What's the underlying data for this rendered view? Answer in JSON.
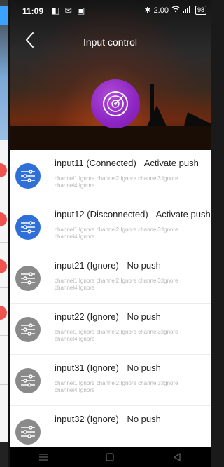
{
  "status_bar": {
    "time": "11:09",
    "left_icons": "◧ ✉ ▣",
    "speed": "2.00",
    "battery": "98"
  },
  "header": {
    "title": "Input control",
    "back_icon": "chevron-left-icon",
    "badge_icon": "radar-icon"
  },
  "inputs": [
    {
      "name": "input11",
      "state": "(Connected)",
      "push": "Activate push",
      "channels": [
        "channel1:Ignore  channel2:Ignore  channel3:Ignore",
        "channel4:Ignore"
      ],
      "icon_color": "#2e6fd8"
    },
    {
      "name": "input12",
      "state": "(Disconnected)",
      "push": "Activate push",
      "channels": [
        "channel1:Ignore  channel2:Ignore  channel3:Ignore",
        "channel4:Ignore"
      ],
      "icon_color": "#2e6fd8"
    },
    {
      "name": "input21",
      "state": "(Ignore)",
      "push": "No push",
      "channels": [
        "channel1:Ignore  channel2:Ignore  channel3:Ignore",
        "channel4:Ignore"
      ],
      "icon_color": "#8a8a8a"
    },
    {
      "name": "input22",
      "state": "(Ignore)",
      "push": "No push",
      "channels": [
        "channel1:Ignore  channel2:Ignore  channel3:Ignore",
        "channel4:Ignore"
      ],
      "icon_color": "#8a8a8a"
    },
    {
      "name": "input31",
      "state": "(Ignore)",
      "push": "No push",
      "channels": [
        "channel1:Ignore  channel2:Ignore  channel3:Ignore",
        "channel4:Ignore"
      ],
      "icon_color": "#8a8a8a"
    },
    {
      "name": "input32",
      "state": "(Ignore)",
      "push": "No push",
      "channels": [
        "",
        ""
      ],
      "icon_color": "#8a8a8a"
    }
  ],
  "nav": {
    "menu_icon": "menu-icon",
    "home_icon": "home-square-icon",
    "back_icon": "back-triangle-icon"
  },
  "colors": {
    "accent_blue": "#2e6fd8",
    "ignored_gray": "#8a8a8a",
    "badge_purple": "#8c25c2"
  }
}
